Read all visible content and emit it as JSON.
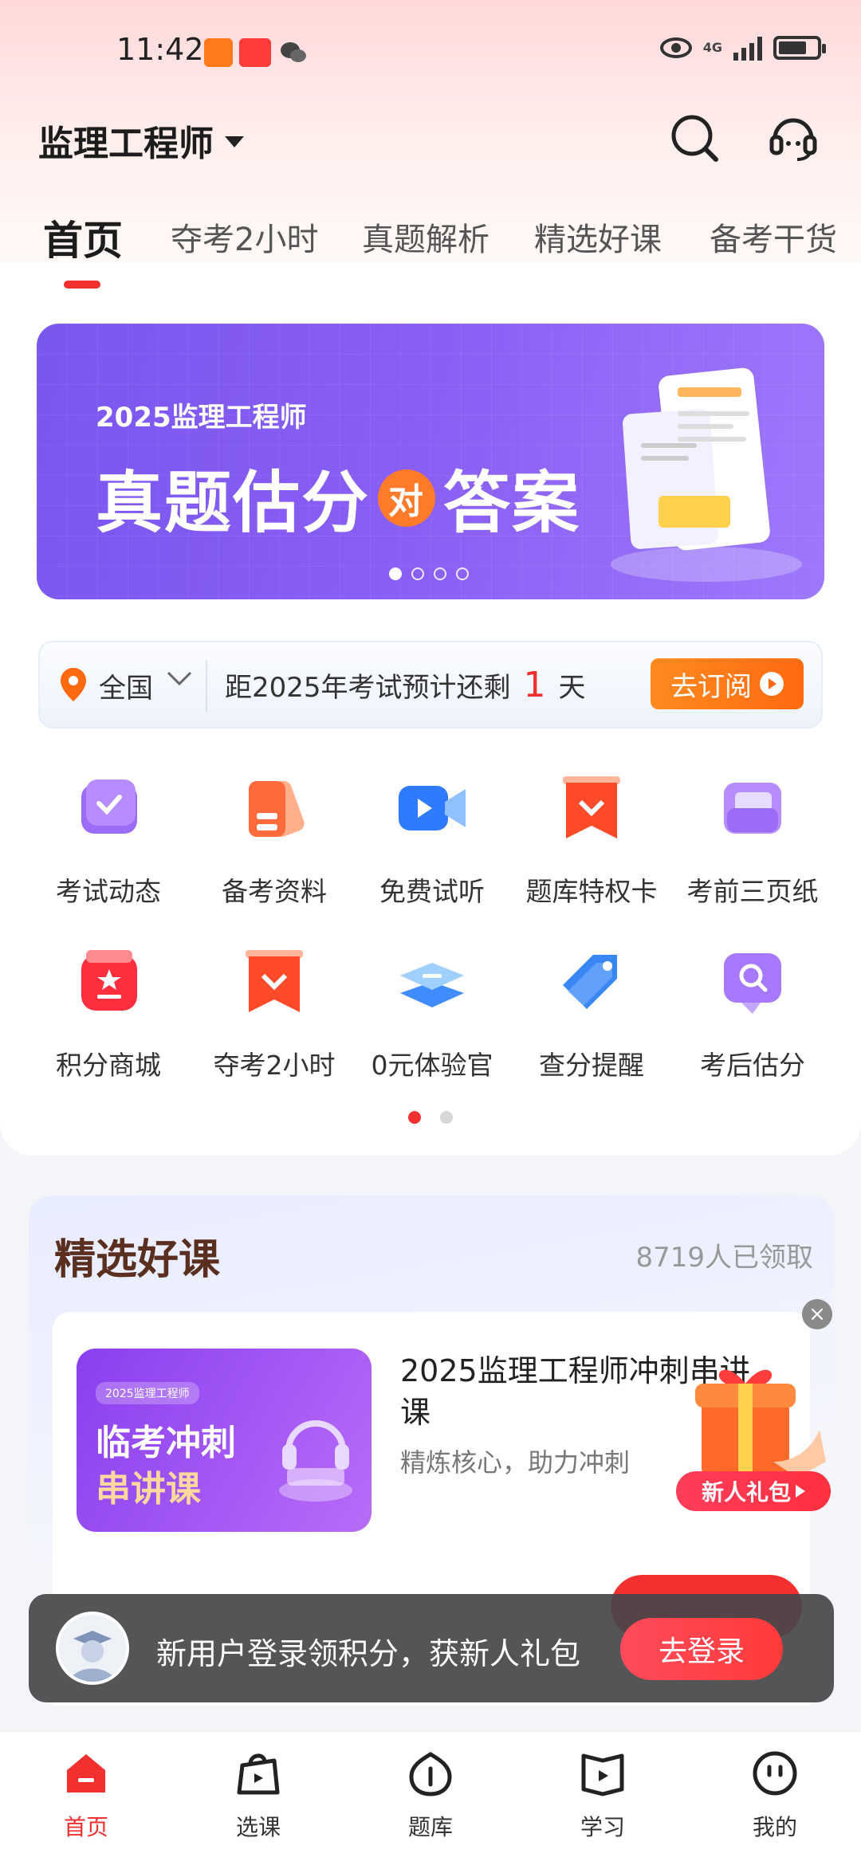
{
  "status_bar": {
    "time": "11:42",
    "network": "4G"
  },
  "header": {
    "title": "监理工程师"
  },
  "tabs": [
    {
      "label": "首页",
      "active": true
    },
    {
      "label": "夺考2小时"
    },
    {
      "label": "真题解析"
    },
    {
      "label": "精选好课"
    },
    {
      "label": "备考干货"
    }
  ],
  "banner": {
    "subtitle": "2025监理工程师",
    "title_left": "真题估分",
    "title_badge": "对",
    "title_right": "答案",
    "slide_count": 4,
    "active_slide": 1
  },
  "countdown": {
    "region": "全国",
    "text_before": "距2025年考试预计还剩",
    "days": "1",
    "text_after": "天",
    "button_label": "去订阅"
  },
  "shortcuts": [
    {
      "label": "考试动态",
      "icon": "calendar-check-icon"
    },
    {
      "label": "备考资料",
      "icon": "materials-icon"
    },
    {
      "label": "免费试听",
      "icon": "video-camera-icon"
    },
    {
      "label": "题库特权卡",
      "icon": "privilege-card-icon"
    },
    {
      "label": "考前三页纸",
      "icon": "folder-icon"
    },
    {
      "label": "积分商城",
      "icon": "points-mall-icon"
    },
    {
      "label": "夺考2小时",
      "icon": "bookmark-icon"
    },
    {
      "label": "0元体验官",
      "icon": "layers-icon"
    },
    {
      "label": "查分提醒",
      "icon": "tag-icon"
    },
    {
      "label": "考后估分",
      "icon": "search-chat-icon"
    }
  ],
  "shortcut_pages": 2,
  "course_section": {
    "title": "精选好课",
    "claimed_count": "8719人已领取",
    "course": {
      "thumb_tag": "2025监理工程师",
      "thumb_line1": "临考冲刺",
      "thumb_line2": "串讲课",
      "name": "2025监理工程师冲刺串讲课",
      "description": "精炼核心，助力冲刺"
    }
  },
  "gift_popup": {
    "badge_label": "新人礼包"
  },
  "login_toast": {
    "message": "新用户登录领积分，获新人礼包",
    "button_label": "去登录"
  },
  "bottom_nav": [
    {
      "label": "首页",
      "active": true
    },
    {
      "label": "选课"
    },
    {
      "label": "题库"
    },
    {
      "label": "学习"
    },
    {
      "label": "我的"
    }
  ],
  "colors": {
    "accent": "#f23030",
    "banner": "#8a5ff5",
    "cta_orange": "#ff6a10"
  }
}
